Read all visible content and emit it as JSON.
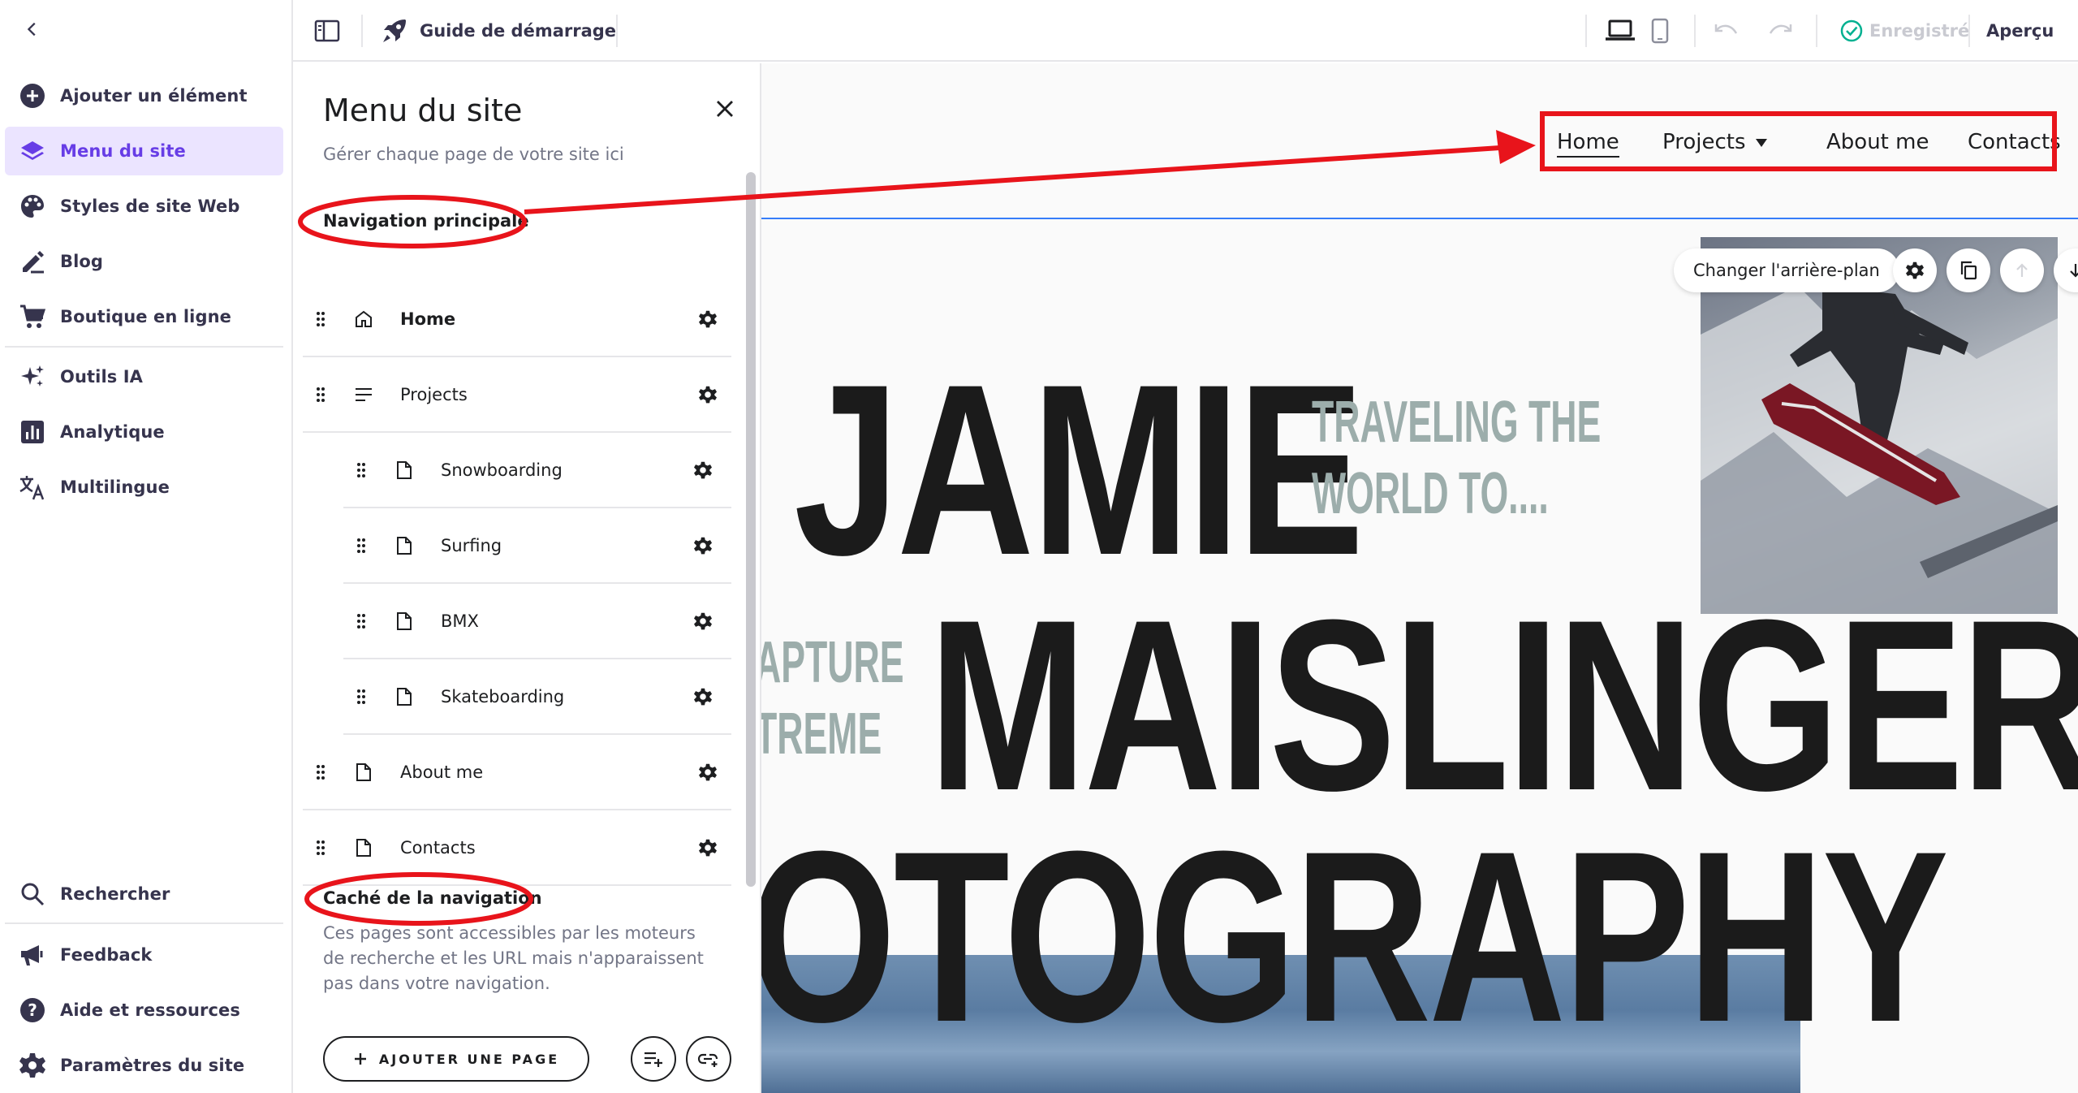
{
  "sidebar": {
    "items": [
      {
        "label": "Ajouter un élément",
        "icon": "plus-circle-icon"
      },
      {
        "label": "Menu du site",
        "icon": "layers-icon"
      },
      {
        "label": "Styles de site Web",
        "icon": "palette-icon"
      },
      {
        "label": "Blog",
        "icon": "pen-icon"
      },
      {
        "label": "Boutique en ligne",
        "icon": "cart-icon"
      },
      {
        "label": "Outils IA",
        "icon": "sparkle-icon"
      },
      {
        "label": "Analytique",
        "icon": "bar-chart-icon"
      },
      {
        "label": "Multilingue",
        "icon": "translate-icon"
      }
    ],
    "bottom_items": [
      {
        "label": "Rechercher",
        "icon": "search-icon"
      },
      {
        "label": "Feedback",
        "icon": "megaphone-icon"
      },
      {
        "label": "Aide et ressources",
        "icon": "help-icon"
      },
      {
        "label": "Paramètres du site",
        "icon": "gear-icon"
      }
    ]
  },
  "topbar": {
    "guide_label": "Guide de démarrage",
    "saved_label": "Enregistré",
    "preview_label": "Aperçu"
  },
  "panel": {
    "title": "Menu du site",
    "subtitle": "Gérer chaque page de votre site ici",
    "main_nav_heading": "Navigation principale",
    "pages": [
      {
        "label": "Home",
        "icon": "home-icon",
        "level": 0
      },
      {
        "label": "Projects",
        "icon": "menu-lines-icon",
        "level": 0
      },
      {
        "label": "Snowboarding",
        "icon": "page-icon",
        "level": 1
      },
      {
        "label": "Surfing",
        "icon": "page-icon",
        "level": 1
      },
      {
        "label": "BMX",
        "icon": "page-icon",
        "level": 1
      },
      {
        "label": "Skateboarding",
        "icon": "page-icon",
        "level": 1
      },
      {
        "label": "About me",
        "icon": "page-icon",
        "level": 0
      },
      {
        "label": "Contacts",
        "icon": "page-icon",
        "level": 0
      }
    ],
    "hidden_heading": "Caché de la navigation",
    "hidden_description": "Ces pages sont accessibles par les moteurs de recherche et les URL mais n'apparaissent pas dans votre navigation.",
    "add_page_label": "AJOUTER UNE PAGE"
  },
  "canvas": {
    "nav": {
      "home": "Home",
      "projects": "Projects",
      "about": "About me",
      "contacts": "Contacts"
    },
    "hero": {
      "line1": "JAMIE",
      "line2": "MAISLINGER",
      "line3": "OTOGRAPHY",
      "tag1a": "TRAVELING THE",
      "tag1b": "WORLD TO....",
      "tag2a": "APTURE",
      "tag2b": "TREME"
    },
    "change_bg_label": "Changer l'arrière-plan"
  },
  "colors": {
    "accent": "#673de6",
    "accent_bg": "#ebe4ff",
    "annotation_red": "#e8141b",
    "saved_green": "#00b090",
    "tag_gray": "#9cadab",
    "selection_blue": "#357df9"
  }
}
